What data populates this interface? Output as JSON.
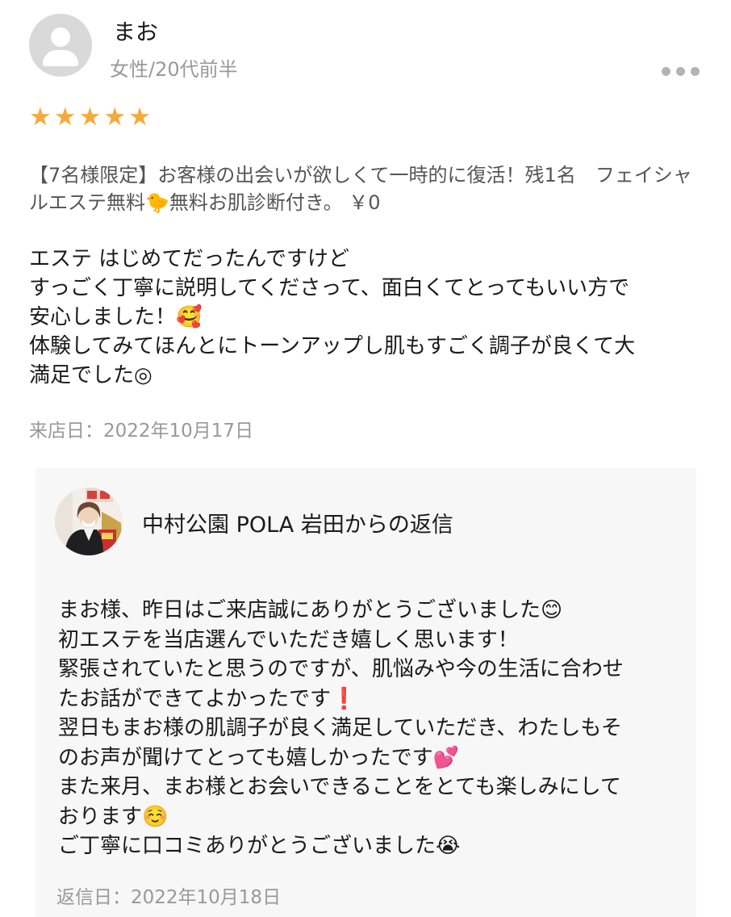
{
  "review": {
    "user_name": "まお",
    "user_meta": "女性/20代前半",
    "rating": 5,
    "plan": "【7名様限定】お客様の出会いが欲しくて一時的に復活！残1名　フェイシャルエステ無料🐤無料お肌診断付き。 ￥0",
    "body_lines": [
      "エステ はじめてだったんですけど",
      "すっごく丁寧に説明してくださって、面白くてとってもいい方で",
      "安心しました！🥰",
      "体験してみてほんとにトーンアップし肌もすごく調子が良くて大",
      "満足でした◎"
    ],
    "visit_date": "来店日：2022年10月17日"
  },
  "reply": {
    "shop_name": "中村公園 POLA 岩田からの返信",
    "body_lines": [
      "まお様、昨日はご来店誠にありがとうございました😊",
      "初エステを当店選んでいただき嬉しく思います！",
      "緊張されていたと思うのですが、肌悩みや今の生活に合わせ",
      "たお話ができてよかったです❗️",
      "翌日もまお様の肌調子が良く満足していただき、わたしもそ",
      "のお声が聞けてとっても嬉しかったです💕",
      "また来月、まお様とお会いできることをとても楽しみにして",
      "おります☺️",
      "ご丁寧に口コミありがとうございました😭"
    ],
    "reply_date": "返信日：2022年10月18日"
  },
  "icons": {
    "user_avatar": "user-silhouette-icon",
    "more": "more-horizontal-icon",
    "star": "star-icon",
    "shop_avatar": "shop-staff-photo"
  },
  "colors": {
    "star": "#f6a93b",
    "muted_text": "#999999",
    "reply_background": "#f7f7f7"
  }
}
